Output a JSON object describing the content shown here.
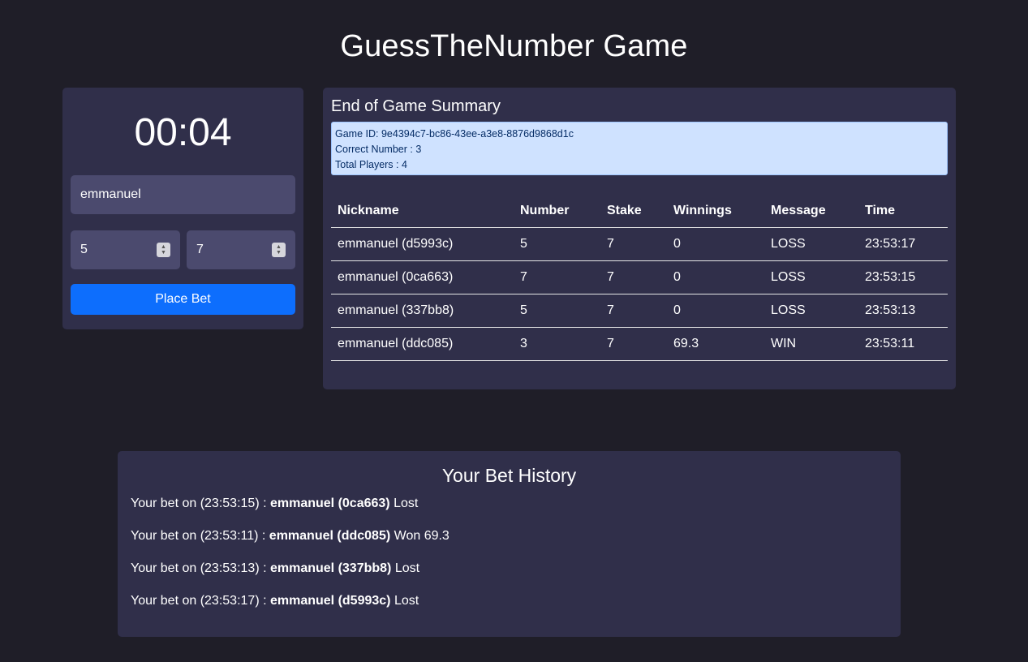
{
  "app": {
    "title": "GuessTheNumber Game"
  },
  "bet_form": {
    "timer": "00:04",
    "nickname_value": "emmanuel",
    "number_value": "5",
    "stake_value": "7",
    "place_bet_label": "Place Bet",
    "button_color": "#0d6efd"
  },
  "summary": {
    "title": "End of Game Summary",
    "game_id": "Game ID: 9e4394c7-bc86-43ee-a3e8-8876d9868d1c",
    "correct_number": "Correct Number : 3",
    "total_players": "Total Players : 4",
    "columns": [
      "Nickname",
      "Number",
      "Stake",
      "Winnings",
      "Message",
      "Time"
    ],
    "rows": [
      [
        "emmanuel (d5993c)",
        "5",
        "7",
        "0",
        "LOSS",
        "23:53:17"
      ],
      [
        "emmanuel (0ca663)",
        "7",
        "7",
        "0",
        "LOSS",
        "23:53:15"
      ],
      [
        "emmanuel (337bb8)",
        "5",
        "7",
        "0",
        "LOSS",
        "23:53:13"
      ],
      [
        "emmanuel (ddc085)",
        "3",
        "7",
        "69.3",
        "WIN",
        "23:53:11"
      ]
    ]
  },
  "history": {
    "title": "Your Bet History",
    "items": [
      {
        "prefix": "Your bet on (23:53:15) : ",
        "player": "emmanuel (0ca663)",
        "result": " Lost"
      },
      {
        "prefix": "Your bet on (23:53:11) : ",
        "player": "emmanuel (ddc085)",
        "result": " Won 69.3"
      },
      {
        "prefix": "Your bet on (23:53:13) : ",
        "player": "emmanuel (337bb8)",
        "result": " Lost"
      },
      {
        "prefix": "Your bet on (23:53:17) : ",
        "player": "emmanuel (d5993c)",
        "result": " Lost"
      }
    ]
  }
}
